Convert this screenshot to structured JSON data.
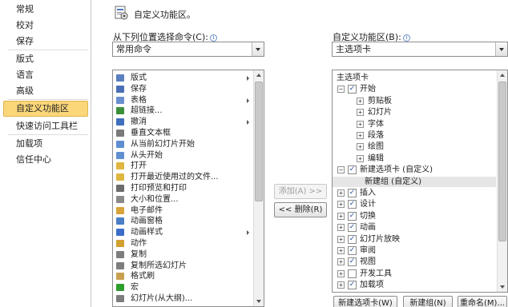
{
  "nav": {
    "items": [
      {
        "label": "常规",
        "selected": false
      },
      {
        "label": "校对",
        "selected": false
      },
      {
        "label": "保存",
        "selected": false
      },
      {
        "label": "版式",
        "selected": false
      },
      {
        "label": "语言",
        "selected": false
      },
      {
        "label": "高级",
        "selected": false
      },
      {
        "label": "自定义功能区",
        "selected": true
      },
      {
        "label": "快速访问工具栏",
        "selected": false
      },
      {
        "label": "加载项",
        "selected": false
      },
      {
        "label": "信任中心",
        "selected": false
      }
    ]
  },
  "header": {
    "title": "自定义功能区。"
  },
  "left": {
    "label": "从下列位置选择命令(C):",
    "combo_value": "常用命令",
    "commands": [
      {
        "label": "版式",
        "arrow": true,
        "icon": "layout-icon",
        "color": "#5b7fbf"
      },
      {
        "label": "保存",
        "arrow": false,
        "icon": "save-icon",
        "color": "#4a6fb5"
      },
      {
        "label": "表格",
        "arrow": true,
        "icon": "table-icon",
        "color": "#6a8fcf"
      },
      {
        "label": "超链接...",
        "arrow": false,
        "icon": "hyperlink-icon",
        "color": "#3c8f3c"
      },
      {
        "label": "撤消",
        "arrow": true,
        "icon": "undo-icon",
        "color": "#3f6fbd"
      },
      {
        "label": "垂直文本框",
        "arrow": false,
        "icon": "vertical-textbox-icon",
        "color": "#7a7a7a"
      },
      {
        "label": "从当前幻灯片开始",
        "arrow": false,
        "icon": "start-current-slide-icon",
        "color": "#5f8fd0"
      },
      {
        "label": "从头开始",
        "arrow": false,
        "icon": "start-beginning-icon",
        "color": "#5f8fd0"
      },
      {
        "label": "打开",
        "arrow": false,
        "icon": "open-icon",
        "color": "#e0b640"
      },
      {
        "label": "打开最近使用过的文件...",
        "arrow": false,
        "icon": "recent-file-icon",
        "color": "#e0b640"
      },
      {
        "label": "打印预览和打印",
        "arrow": false,
        "icon": "print-preview-icon",
        "color": "#6b6b6b"
      },
      {
        "label": "大小和位置...",
        "arrow": false,
        "icon": "size-position-icon",
        "color": "#8a8a8a"
      },
      {
        "label": "电子邮件",
        "arrow": false,
        "icon": "email-icon",
        "color": "#d8a33a"
      },
      {
        "label": "动画窗格",
        "arrow": false,
        "icon": "animation-pane-icon",
        "color": "#4a7fc7"
      },
      {
        "label": "动画样式",
        "arrow": true,
        "icon": "animation-style-icon",
        "color": "#3c6ec9"
      },
      {
        "label": "动作",
        "arrow": false,
        "icon": "action-icon",
        "color": "#d0a030"
      },
      {
        "label": "复制",
        "arrow": false,
        "icon": "copy-icon",
        "color": "#7d7d7d"
      },
      {
        "label": "复制所选幻灯片",
        "arrow": false,
        "icon": "duplicate-slide-icon",
        "color": "#7d7d7d"
      },
      {
        "label": "格式刷",
        "arrow": false,
        "icon": "format-painter-icon",
        "color": "#c8a050"
      },
      {
        "label": "宏",
        "arrow": false,
        "icon": "macro-icon",
        "color": "#2f9c2f"
      },
      {
        "label": "幻灯片(从大纲)...",
        "arrow": false,
        "icon": "slides-from-outline-icon",
        "color": "#7d7d7d"
      }
    ]
  },
  "middle": {
    "add_label": "添加(A) >>",
    "remove_label": "<< 删除(R)"
  },
  "right": {
    "label": "自定义功能区(B):",
    "combo_value": "主选项卡",
    "tree": [
      {
        "label": "主选项卡",
        "level": 0,
        "expander": "",
        "checkbox": false,
        "checked": false,
        "highlight": false
      },
      {
        "label": "开始",
        "level": 1,
        "expander": "−",
        "checkbox": true,
        "checked": true,
        "highlight": false
      },
      {
        "label": "剪贴板",
        "level": 2,
        "expander": "+",
        "checkbox": false,
        "checked": false,
        "highlight": false
      },
      {
        "label": "幻灯片",
        "level": 2,
        "expander": "+",
        "checkbox": false,
        "checked": false,
        "highlight": false
      },
      {
        "label": "字体",
        "level": 2,
        "expander": "+",
        "checkbox": false,
        "checked": false,
        "highlight": false
      },
      {
        "label": "段落",
        "level": 2,
        "expander": "+",
        "checkbox": false,
        "checked": false,
        "highlight": false
      },
      {
        "label": "绘图",
        "level": 2,
        "expander": "+",
        "checkbox": false,
        "checked": false,
        "highlight": false
      },
      {
        "label": "编辑",
        "level": 2,
        "expander": "+",
        "checkbox": false,
        "checked": false,
        "highlight": false
      },
      {
        "label": "新建选项卡 (自定义)",
        "level": 1,
        "expander": "−",
        "checkbox": true,
        "checked": true,
        "highlight": false
      },
      {
        "label": "新建组 (自定义)",
        "level": 3,
        "expander": "",
        "checkbox": false,
        "checked": false,
        "highlight": true
      },
      {
        "label": "插入",
        "level": 1,
        "expander": "+",
        "checkbox": true,
        "checked": true,
        "highlight": false
      },
      {
        "label": "设计",
        "level": 1,
        "expander": "+",
        "checkbox": true,
        "checked": true,
        "highlight": false
      },
      {
        "label": "切换",
        "level": 1,
        "expander": "+",
        "checkbox": true,
        "checked": true,
        "highlight": false
      },
      {
        "label": "动画",
        "level": 1,
        "expander": "+",
        "checkbox": true,
        "checked": true,
        "highlight": false
      },
      {
        "label": "幻灯片放映",
        "level": 1,
        "expander": "+",
        "checkbox": true,
        "checked": true,
        "highlight": false
      },
      {
        "label": "审阅",
        "level": 1,
        "expander": "+",
        "checkbox": true,
        "checked": true,
        "highlight": false
      },
      {
        "label": "视图",
        "level": 1,
        "expander": "+",
        "checkbox": true,
        "checked": true,
        "highlight": false
      },
      {
        "label": "开发工具",
        "level": 1,
        "expander": "+",
        "checkbox": true,
        "checked": false,
        "highlight": false
      },
      {
        "label": "加载项",
        "level": 1,
        "expander": "+",
        "checkbox": true,
        "checked": true,
        "highlight": false
      }
    ],
    "buttons": {
      "new_tab": "新建选项卡(W)",
      "new_group": "新建组(N)",
      "rename": "重命名(M)..."
    }
  }
}
